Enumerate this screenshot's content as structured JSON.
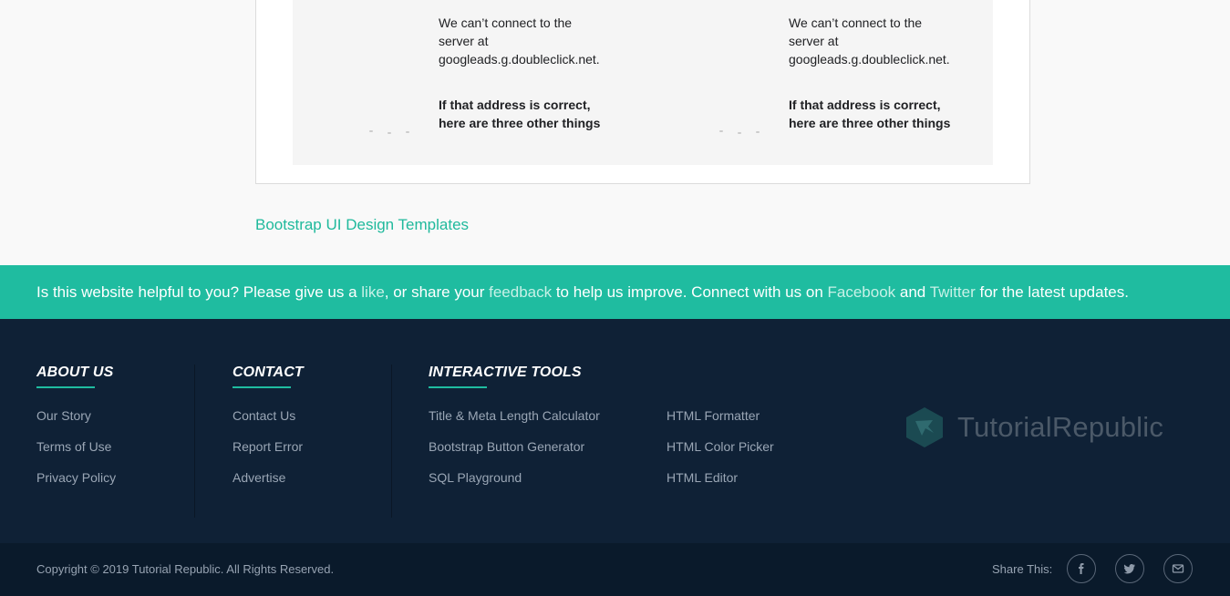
{
  "preview": {
    "blocks": [
      {
        "line1": "We can’t connect to the",
        "line2": "server at",
        "line3": "googleads.g.doubleclick.net.",
        "bold1": "If that address is correct,",
        "bold2": "here are three other things"
      },
      {
        "line1": "We can’t connect to the",
        "line2": "server at",
        "line3": "googleads.g.doubleclick.net.",
        "bold1": "If that address is correct,",
        "bold2": "here are three other things"
      }
    ]
  },
  "templates_link": "Bootstrap UI Design Templates",
  "banner": {
    "part1": "Is this website helpful to you? Please give us a ",
    "like": "like",
    "part2": ", or share your ",
    "feedback": "feedback",
    "part3": " to help us improve. Connect with us on ",
    "facebook": "Facebook",
    "part4": " and ",
    "twitter": "Twitter",
    "part5": " for the latest updates."
  },
  "footer": {
    "about": {
      "title": "ABOUT US",
      "items": [
        "Our Story",
        "Terms of Use",
        "Privacy Policy"
      ]
    },
    "contact": {
      "title": "CONTACT",
      "items": [
        "Contact Us",
        "Report Error",
        "Advertise"
      ]
    },
    "tools": {
      "title": "INTERACTIVE TOOLS",
      "col1": [
        "Title & Meta Length Calculator",
        "Bootstrap Button Generator",
        "SQL Playground"
      ],
      "col2": [
        "HTML Formatter",
        "HTML Color Picker",
        "HTML Editor"
      ]
    },
    "brand": "TutorialRepublic"
  },
  "bottom": {
    "copyright": "Copyright © 2019 Tutorial Republic. All Rights Reserved.",
    "share_label": "Share This:",
    "share_icons": [
      "facebook-icon",
      "twitter-icon",
      "email-icon"
    ]
  },
  "colors": {
    "accent": "#1fbca0",
    "footer_bg": "#0f2136",
    "bottom_bg": "#0a1a2b"
  }
}
